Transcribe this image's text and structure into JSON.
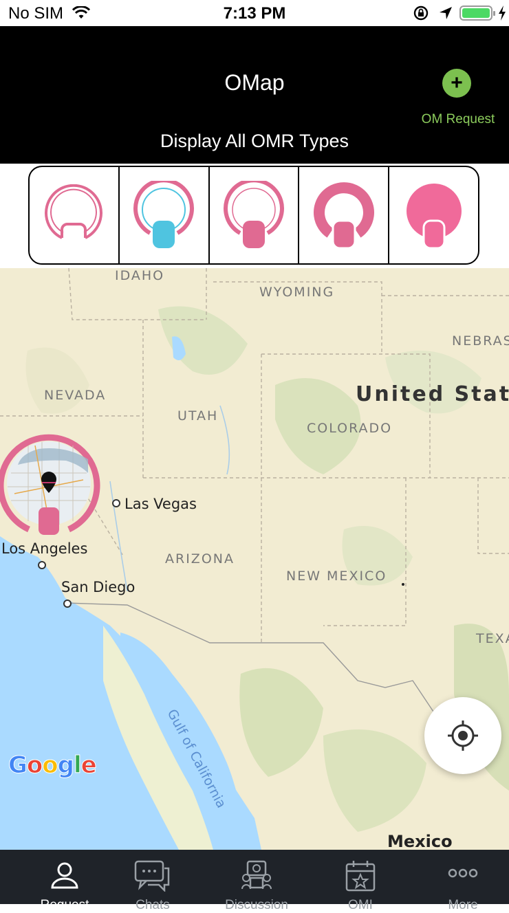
{
  "status_bar": {
    "carrier": "No SIM",
    "time": "7:13 PM",
    "battery_color": "#4cd964"
  },
  "header": {
    "title": "OMap",
    "subtitle": "Display All OMR Types",
    "request_label": "OM Request",
    "add_icon": "plus-circle-icon",
    "accent": "#7cc04f"
  },
  "filters": [
    {
      "name": "omr-type-outline",
      "color": "#e06a92"
    },
    {
      "name": "omr-type-blue",
      "color": "#4fc4e0"
    },
    {
      "name": "omr-type-pink-tag",
      "color": "#e06a92"
    },
    {
      "name": "omr-type-thick-ring",
      "color": "#e06a92"
    },
    {
      "name": "omr-type-filled",
      "color": "#f06a9a"
    }
  ],
  "map": {
    "states": {
      "idaho": "IDAHO",
      "wyoming": "WYOMING",
      "nebraska": "NEBRAS",
      "nevada": "NEVADA",
      "utah": "UTAH",
      "colorado": "COLORADO",
      "arizona": "ARIZONA",
      "new_mexico": "NEW MEXICO",
      "texas": "TEXA"
    },
    "country": "United State",
    "cities": {
      "las_vegas": "Las Vegas",
      "los_angeles": "Los Angeles",
      "san_diego": "San Diego"
    },
    "gulf": "Gulf of California",
    "mexico": "Mexico",
    "attribution": "Google"
  },
  "tabbar": {
    "tabs": [
      {
        "icon": "person-icon",
        "label": "Request"
      },
      {
        "icon": "chat-icon",
        "label": "Chats"
      },
      {
        "icon": "discussion-icon",
        "label": "Discussion"
      },
      {
        "icon": "calendar-star-icon",
        "label": "OMI"
      },
      {
        "icon": "more-icon",
        "label": "More"
      }
    ]
  }
}
